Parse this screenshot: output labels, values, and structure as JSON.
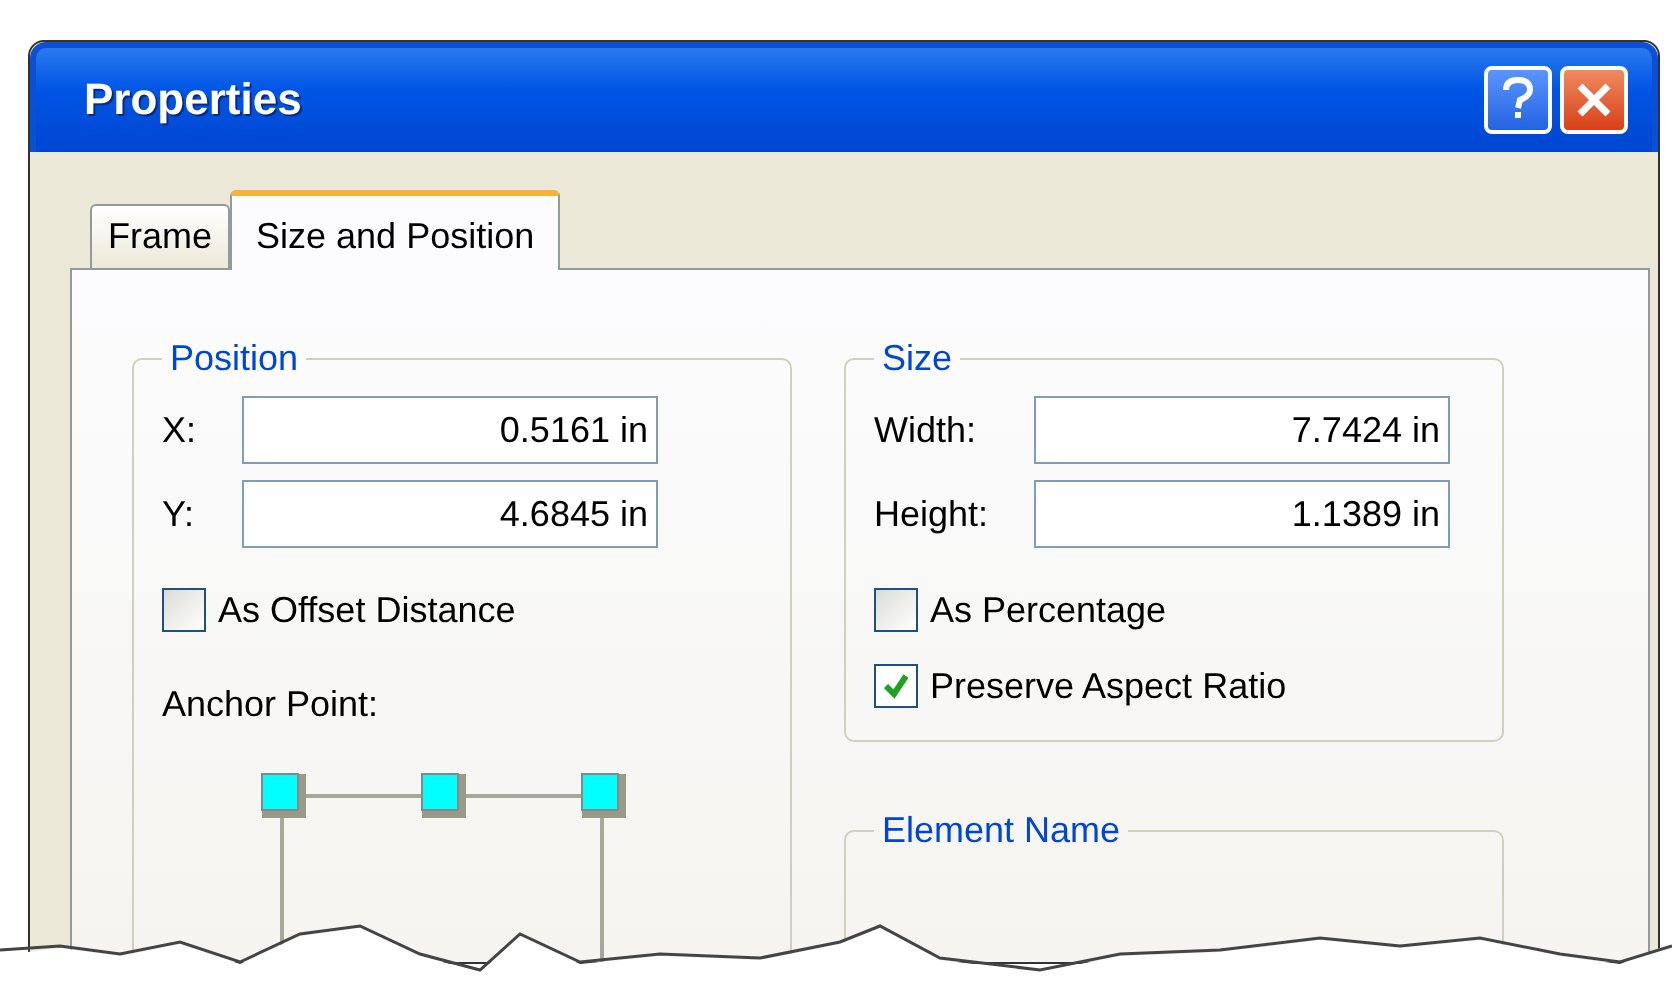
{
  "window": {
    "title": "Properties"
  },
  "tabs": [
    {
      "label": "Frame",
      "selected": false
    },
    {
      "label": "Size and Position",
      "selected": true
    }
  ],
  "position": {
    "title": "Position",
    "fields": [
      {
        "label": "X:",
        "value": "0.5161 in"
      },
      {
        "label": "Y:",
        "value": "4.6845 in"
      }
    ],
    "checkboxes": [
      {
        "label": "As Offset Distance",
        "checked": false
      }
    ],
    "anchor_label": "Anchor Point:"
  },
  "size": {
    "title": "Size",
    "fields": [
      {
        "label": "Width:",
        "value": "7.7424 in"
      },
      {
        "label": "Height:",
        "value": "1.1389 in"
      }
    ],
    "checkboxes": [
      {
        "label": "As Percentage",
        "checked": false
      },
      {
        "label": "Preserve Aspect Ratio",
        "checked": true
      }
    ]
  },
  "element_name": {
    "title": "Element Name"
  }
}
